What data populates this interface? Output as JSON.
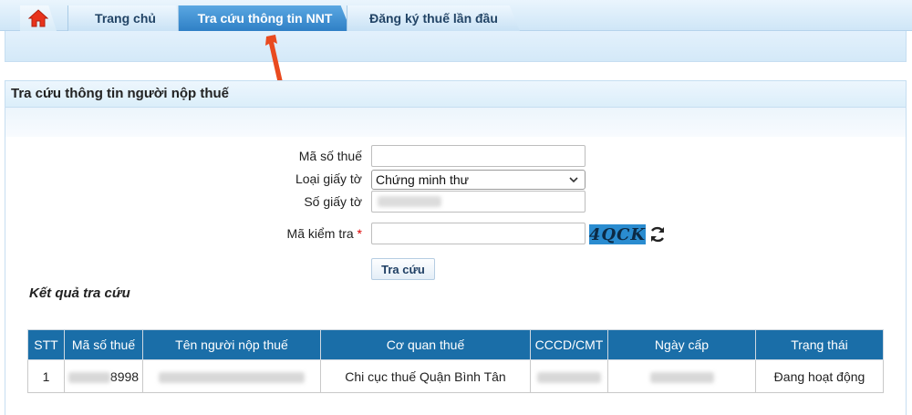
{
  "nav": {
    "home_icon": "home-icon",
    "tabs": [
      {
        "label": "Trang chủ"
      },
      {
        "label": "Tra cứu thông tin NNT"
      },
      {
        "label": "Đăng ký thuế lần đầu"
      }
    ],
    "active_color": "#2f80c6"
  },
  "panel": {
    "title": "Tra cứu thông tin người nộp thuế"
  },
  "form": {
    "tax_code_label": "Mã số thuế",
    "tax_code_value": "",
    "doc_type_label": "Loại giấy tờ",
    "doc_type_selected": "Chứng minh thư",
    "doc_number_label": "Số giấy tờ",
    "captcha_label": "Mã kiểm tra",
    "required_mark": "*",
    "captcha_value": "",
    "captcha_text": "4QCK",
    "submit_label": "Tra cứu"
  },
  "results": {
    "title": "Kết quả tra cứu",
    "columns": [
      "STT",
      "Mã số thuế",
      "Tên người nộp thuế",
      "Cơ quan thuế",
      "CCCD/CMT",
      "Ngày cấp",
      "Trạng thái"
    ],
    "rows": [
      {
        "stt": "1",
        "tax_code_suffix": "8998",
        "agency": "Chi cục thuế Quận Bình Tân",
        "status": "Đang hoạt động"
      }
    ],
    "header_color": "#1a6ea8"
  }
}
